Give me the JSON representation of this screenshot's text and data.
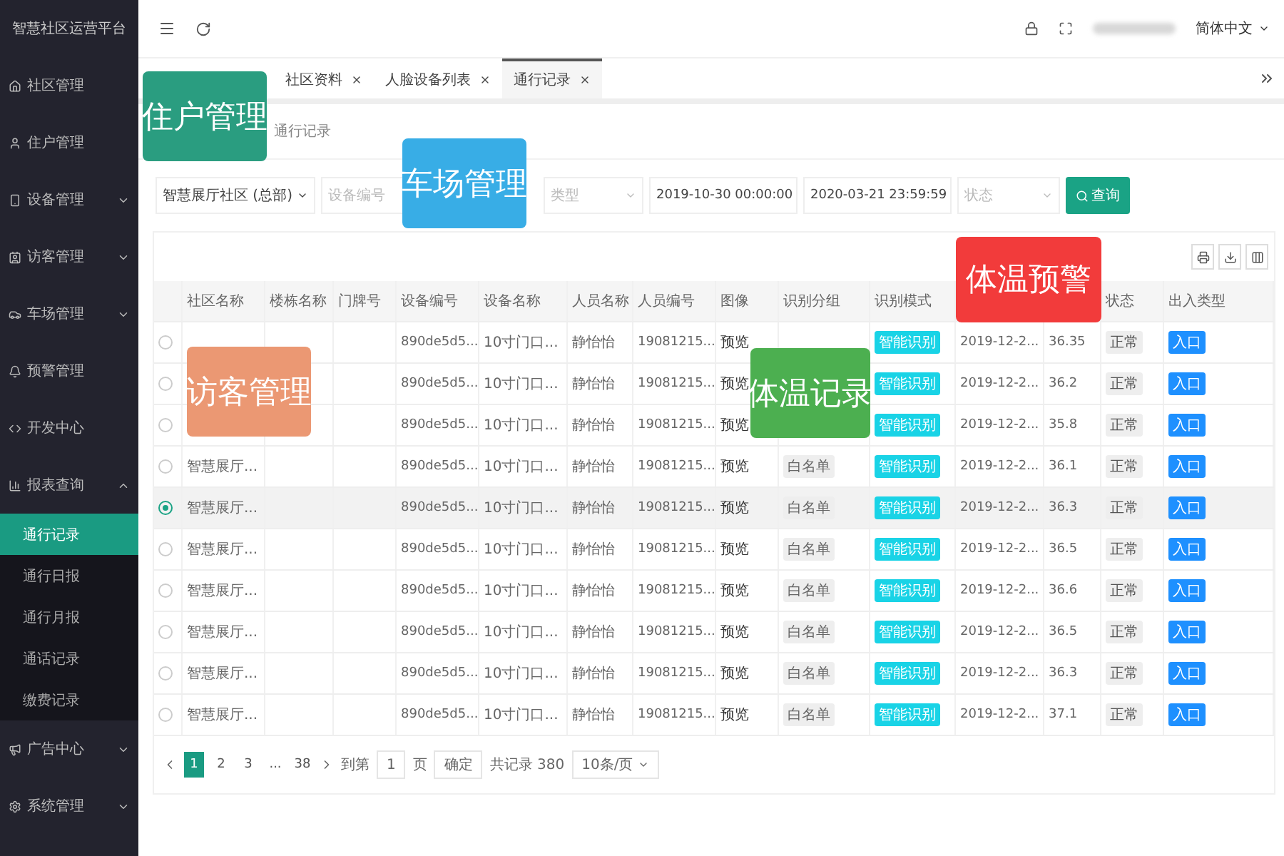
{
  "sidebar": {
    "title": "智慧社区运营平台",
    "items": [
      {
        "label": "社区管理",
        "kind": "link"
      },
      {
        "label": "住户管理",
        "kind": "link"
      },
      {
        "label": "设备管理",
        "kind": "menu",
        "expanded": false
      },
      {
        "label": "访客管理",
        "kind": "menu",
        "expanded": false
      },
      {
        "label": "车场管理",
        "kind": "menu",
        "expanded": false
      },
      {
        "label": "预警管理",
        "kind": "link"
      },
      {
        "label": "开发中心",
        "kind": "link"
      },
      {
        "label": "报表查询",
        "kind": "menu",
        "expanded": true,
        "children": [
          {
            "label": "通行记录",
            "selected": true
          },
          {
            "label": "通行日报",
            "selected": false
          },
          {
            "label": "通行月报",
            "selected": false
          },
          {
            "label": "通话记录",
            "selected": false
          },
          {
            "label": "缴费记录",
            "selected": false
          }
        ]
      },
      {
        "label": "广告中心",
        "kind": "menu",
        "expanded": false
      },
      {
        "label": "系统管理",
        "kind": "menu",
        "expanded": false
      }
    ]
  },
  "header": {
    "language": "简体中文"
  },
  "tabs": [
    {
      "label": "社区资料",
      "selected": false
    },
    {
      "label": "人脸设备列表",
      "selected": false
    },
    {
      "label": "通行记录",
      "selected": true
    }
  ],
  "breadcrumb": "通行记录",
  "filters": [
    {
      "kind": "select",
      "value": "智慧展厅社区 (总部)"
    },
    {
      "kind": "input",
      "placeholder": "设备编号"
    },
    {
      "kind": "gap"
    },
    {
      "kind": "select",
      "placeholder": "类型"
    },
    {
      "kind": "input",
      "value": "2019-10-30 00:00:00"
    },
    {
      "kind": "input",
      "value": "2020-03-21 23:59:59"
    },
    {
      "kind": "select",
      "placeholder": "状态"
    }
  ],
  "search_button": "查询",
  "table": {
    "columns": [
      "社区名称",
      "楼栋名称",
      "门牌号",
      "设备编号",
      "设备名称",
      "人员名称",
      "人员编号",
      "图像",
      "识别分组",
      "识别模式",
      null,
      null,
      "状态",
      "出入类型"
    ],
    "rows": [
      {
        "selected": false,
        "cells": [
          null,
          null,
          null,
          "890de5d5...",
          "10寸门口...",
          "静怡怡",
          "19081215...",
          "预览",
          null,
          "智能识别",
          "2019-12-2...",
          "36.35",
          "正常",
          "入口"
        ]
      },
      {
        "selected": false,
        "cells": [
          null,
          null,
          null,
          "890de5d5...",
          "10寸门口...",
          "静怡怡",
          "19081215...",
          "预览",
          null,
          "智能识别",
          "2019-12-2...",
          "36.2",
          "正常",
          "入口"
        ]
      },
      {
        "selected": false,
        "cells": [
          null,
          null,
          null,
          "890de5d5...",
          "10寸门口...",
          "静怡怡",
          "19081215...",
          "预览",
          null,
          "智能识别",
          "2019-12-2...",
          "35.8",
          "正常",
          "入口"
        ]
      },
      {
        "selected": false,
        "cells": [
          "智慧展厅...",
          null,
          null,
          "890de5d5...",
          "10寸门口...",
          "静怡怡",
          "19081215...",
          "预览",
          "白名单",
          "智能识别",
          "2019-12-2...",
          "36.1",
          "正常",
          "入口"
        ]
      },
      {
        "selected": true,
        "cells": [
          "智慧展厅...",
          null,
          null,
          "890de5d5...",
          "10寸门口...",
          "静怡怡",
          "19081215...",
          "预览",
          "白名单",
          "智能识别",
          "2019-12-2...",
          "36.3",
          "正常",
          "入口"
        ]
      },
      {
        "selected": false,
        "cells": [
          "智慧展厅...",
          null,
          null,
          "890de5d5...",
          "10寸门口...",
          "静怡怡",
          "19081215...",
          "预览",
          "白名单",
          "智能识别",
          "2019-12-2...",
          "36.5",
          "正常",
          "入口"
        ]
      },
      {
        "selected": false,
        "cells": [
          "智慧展厅...",
          null,
          null,
          "890de5d5...",
          "10寸门口...",
          "静怡怡",
          "19081215...",
          "预览",
          "白名单",
          "智能识别",
          "2019-12-2...",
          "36.6",
          "正常",
          "入口"
        ]
      },
      {
        "selected": false,
        "cells": [
          "智慧展厅...",
          null,
          null,
          "890de5d5...",
          "10寸门口...",
          "静怡怡",
          "19081215...",
          "预览",
          "白名单",
          "智能识别",
          "2019-12-2...",
          "36.5",
          "正常",
          "入口"
        ]
      },
      {
        "selected": false,
        "cells": [
          "智慧展厅...",
          null,
          null,
          "890de5d5...",
          "10寸门口...",
          "静怡怡",
          "19081215...",
          "预览",
          "白名单",
          "智能识别",
          "2019-12-2...",
          "36.3",
          "正常",
          "入口"
        ]
      },
      {
        "selected": false,
        "cells": [
          "智慧展厅...",
          null,
          null,
          "890de5d5...",
          "10寸门口...",
          "静怡怡",
          "19081215...",
          "预览",
          "白名单",
          "智能识别",
          "2019-12-2...",
          "37.1",
          "正常",
          "入口"
        ]
      }
    ]
  },
  "pagination": {
    "pages": [
      {
        "label": "1",
        "selected": true
      },
      {
        "label": "2",
        "selected": false
      },
      {
        "label": "3",
        "selected": false
      },
      {
        "label": "...",
        "selected": false
      },
      {
        "label": "38",
        "selected": false
      }
    ],
    "goto_label": "到第",
    "goto_value": "1",
    "page_unit": "页",
    "confirm": "确定",
    "total": "共记录 380",
    "page_size": "10条/页"
  },
  "overlays": [
    {
      "label": "住户管理",
      "color": "#2a9d80"
    },
    {
      "label": "车场管理",
      "color": "#38ade6"
    },
    {
      "label": "访客管理",
      "color": "#eb9873"
    },
    {
      "label": "体温记录",
      "color": "#4caf50"
    },
    {
      "label": "体温预警",
      "color": "#f23b3b"
    }
  ]
}
